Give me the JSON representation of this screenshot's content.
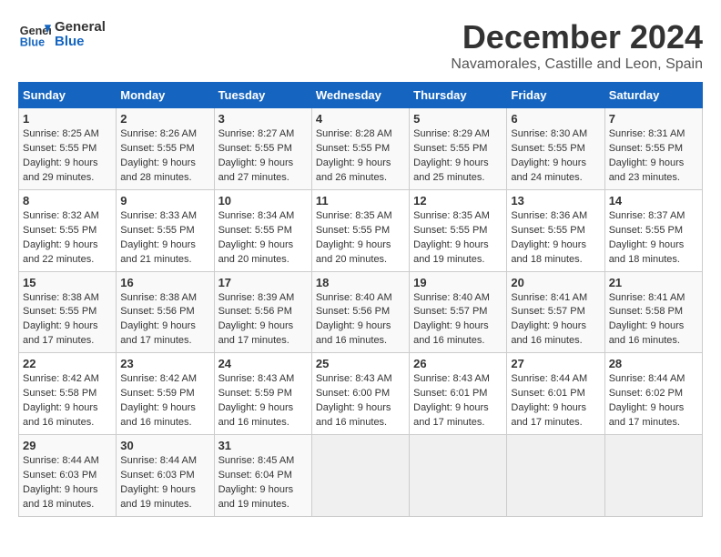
{
  "header": {
    "logo_general": "General",
    "logo_blue": "Blue",
    "month_title": "December 2024",
    "location": "Navamorales, Castille and Leon, Spain"
  },
  "calendar": {
    "weekdays": [
      "Sunday",
      "Monday",
      "Tuesday",
      "Wednesday",
      "Thursday",
      "Friday",
      "Saturday"
    ],
    "weeks": [
      [
        {
          "day": "",
          "info": ""
        },
        {
          "day": "2",
          "info": "Sunrise: 8:26 AM\nSunset: 5:55 PM\nDaylight: 9 hours\nand 28 minutes."
        },
        {
          "day": "3",
          "info": "Sunrise: 8:27 AM\nSunset: 5:55 PM\nDaylight: 9 hours\nand 27 minutes."
        },
        {
          "day": "4",
          "info": "Sunrise: 8:28 AM\nSunset: 5:55 PM\nDaylight: 9 hours\nand 26 minutes."
        },
        {
          "day": "5",
          "info": "Sunrise: 8:29 AM\nSunset: 5:55 PM\nDaylight: 9 hours\nand 25 minutes."
        },
        {
          "day": "6",
          "info": "Sunrise: 8:30 AM\nSunset: 5:55 PM\nDaylight: 9 hours\nand 24 minutes."
        },
        {
          "day": "7",
          "info": "Sunrise: 8:31 AM\nSunset: 5:55 PM\nDaylight: 9 hours\nand 23 minutes."
        }
      ],
      [
        {
          "day": "8",
          "info": "Sunrise: 8:32 AM\nSunset: 5:55 PM\nDaylight: 9 hours\nand 22 minutes."
        },
        {
          "day": "9",
          "info": "Sunrise: 8:33 AM\nSunset: 5:55 PM\nDaylight: 9 hours\nand 21 minutes."
        },
        {
          "day": "10",
          "info": "Sunrise: 8:34 AM\nSunset: 5:55 PM\nDaylight: 9 hours\nand 20 minutes."
        },
        {
          "day": "11",
          "info": "Sunrise: 8:35 AM\nSunset: 5:55 PM\nDaylight: 9 hours\nand 20 minutes."
        },
        {
          "day": "12",
          "info": "Sunrise: 8:35 AM\nSunset: 5:55 PM\nDaylight: 9 hours\nand 19 minutes."
        },
        {
          "day": "13",
          "info": "Sunrise: 8:36 AM\nSunset: 5:55 PM\nDaylight: 9 hours\nand 18 minutes."
        },
        {
          "day": "14",
          "info": "Sunrise: 8:37 AM\nSunset: 5:55 PM\nDaylight: 9 hours\nand 18 minutes."
        }
      ],
      [
        {
          "day": "15",
          "info": "Sunrise: 8:38 AM\nSunset: 5:55 PM\nDaylight: 9 hours\nand 17 minutes."
        },
        {
          "day": "16",
          "info": "Sunrise: 8:38 AM\nSunset: 5:56 PM\nDaylight: 9 hours\nand 17 minutes."
        },
        {
          "day": "17",
          "info": "Sunrise: 8:39 AM\nSunset: 5:56 PM\nDaylight: 9 hours\nand 17 minutes."
        },
        {
          "day": "18",
          "info": "Sunrise: 8:40 AM\nSunset: 5:56 PM\nDaylight: 9 hours\nand 16 minutes."
        },
        {
          "day": "19",
          "info": "Sunrise: 8:40 AM\nSunset: 5:57 PM\nDaylight: 9 hours\nand 16 minutes."
        },
        {
          "day": "20",
          "info": "Sunrise: 8:41 AM\nSunset: 5:57 PM\nDaylight: 9 hours\nand 16 minutes."
        },
        {
          "day": "21",
          "info": "Sunrise: 8:41 AM\nSunset: 5:58 PM\nDaylight: 9 hours\nand 16 minutes."
        }
      ],
      [
        {
          "day": "22",
          "info": "Sunrise: 8:42 AM\nSunset: 5:58 PM\nDaylight: 9 hours\nand 16 minutes."
        },
        {
          "day": "23",
          "info": "Sunrise: 8:42 AM\nSunset: 5:59 PM\nDaylight: 9 hours\nand 16 minutes."
        },
        {
          "day": "24",
          "info": "Sunrise: 8:43 AM\nSunset: 5:59 PM\nDaylight: 9 hours\nand 16 minutes."
        },
        {
          "day": "25",
          "info": "Sunrise: 8:43 AM\nSunset: 6:00 PM\nDaylight: 9 hours\nand 16 minutes."
        },
        {
          "day": "26",
          "info": "Sunrise: 8:43 AM\nSunset: 6:01 PM\nDaylight: 9 hours\nand 17 minutes."
        },
        {
          "day": "27",
          "info": "Sunrise: 8:44 AM\nSunset: 6:01 PM\nDaylight: 9 hours\nand 17 minutes."
        },
        {
          "day": "28",
          "info": "Sunrise: 8:44 AM\nSunset: 6:02 PM\nDaylight: 9 hours\nand 17 minutes."
        }
      ],
      [
        {
          "day": "29",
          "info": "Sunrise: 8:44 AM\nSunset: 6:03 PM\nDaylight: 9 hours\nand 18 minutes."
        },
        {
          "day": "30",
          "info": "Sunrise: 8:44 AM\nSunset: 6:03 PM\nDaylight: 9 hours\nand 19 minutes."
        },
        {
          "day": "31",
          "info": "Sunrise: 8:45 AM\nSunset: 6:04 PM\nDaylight: 9 hours\nand 19 minutes."
        },
        {
          "day": "",
          "info": ""
        },
        {
          "day": "",
          "info": ""
        },
        {
          "day": "",
          "info": ""
        },
        {
          "day": "",
          "info": ""
        }
      ]
    ],
    "first_week_first_day": {
      "day": "1",
      "info": "Sunrise: 8:25 AM\nSunset: 5:55 PM\nDaylight: 9 hours\nand 29 minutes."
    }
  }
}
